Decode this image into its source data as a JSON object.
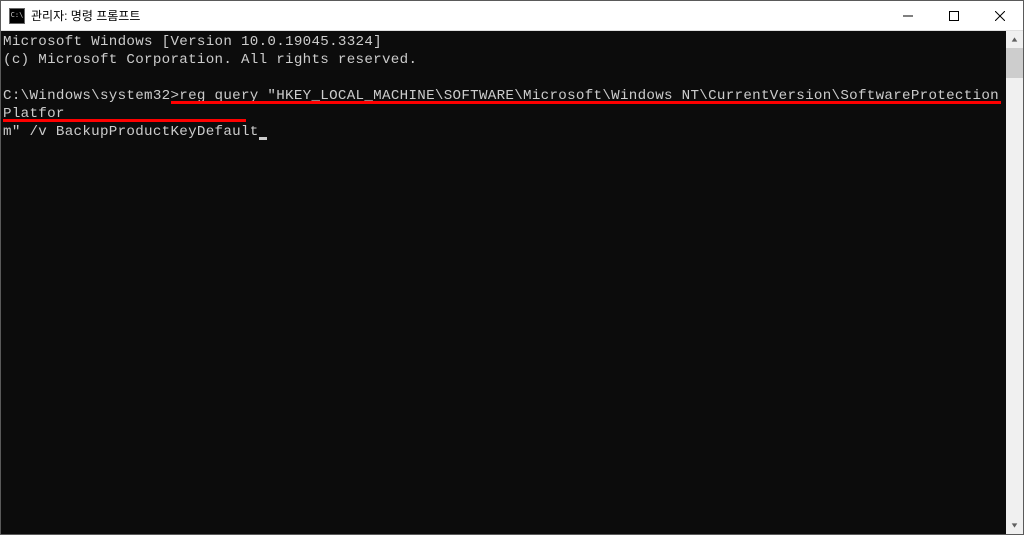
{
  "window": {
    "icon_text": "C:\\",
    "title": "관리자: 명령 프롬프트"
  },
  "terminal": {
    "line1": "Microsoft Windows [Version 10.0.19045.3324]",
    "line2": "(c) Microsoft Corporation. All rights reserved.",
    "prompt": "C:\\Windows\\system32>",
    "command_part1": "reg query \"HKEY_LOCAL_MACHINE\\SOFTWARE\\Microsoft\\Windows NT\\CurrentVersion\\SoftwareProtectionPlatfor",
    "command_part2": "m\" /v BackupProductKeyDefault"
  }
}
